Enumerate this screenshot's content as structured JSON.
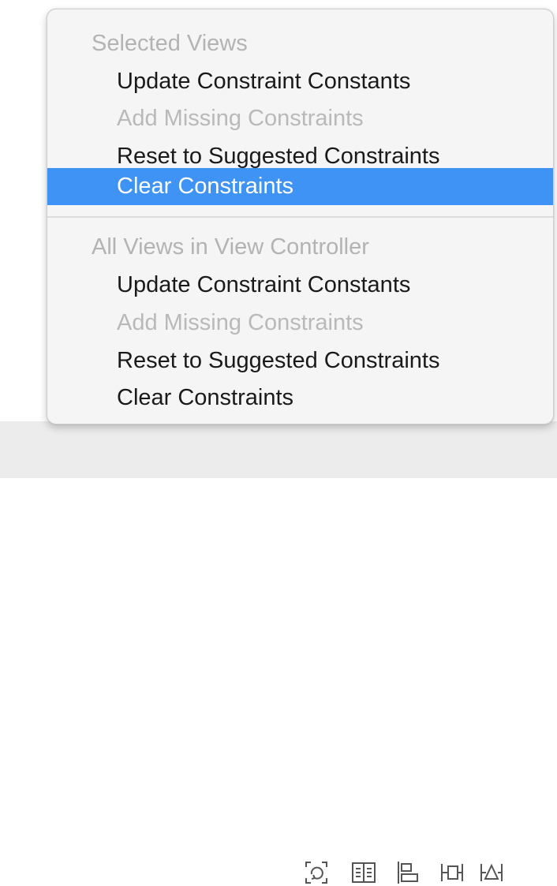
{
  "menu": {
    "sections": [
      {
        "header": "Selected Views",
        "items": [
          {
            "label": "Update Constraint Constants",
            "enabled": true
          },
          {
            "label": "Add Missing Constraints",
            "enabled": false
          },
          {
            "label": "Reset to Suggested Constraints",
            "enabled": true
          },
          {
            "label": "Clear Constraints",
            "enabled": true,
            "highlighted": true
          }
        ]
      },
      {
        "header": "All Views in View Controller",
        "items": [
          {
            "label": "Update Constraint Constants",
            "enabled": true
          },
          {
            "label": "Add Missing Constraints",
            "enabled": false
          },
          {
            "label": "Reset to Suggested Constraints",
            "enabled": true
          },
          {
            "label": "Clear Constraints",
            "enabled": true
          }
        ]
      }
    ],
    "highlight_color": "#3f93f5"
  },
  "toolbar": {
    "icons": [
      "update-frames-icon",
      "embed-in-stack-icon",
      "align-icon",
      "add-constraints-icon",
      "resolve-issues-icon"
    ]
  }
}
